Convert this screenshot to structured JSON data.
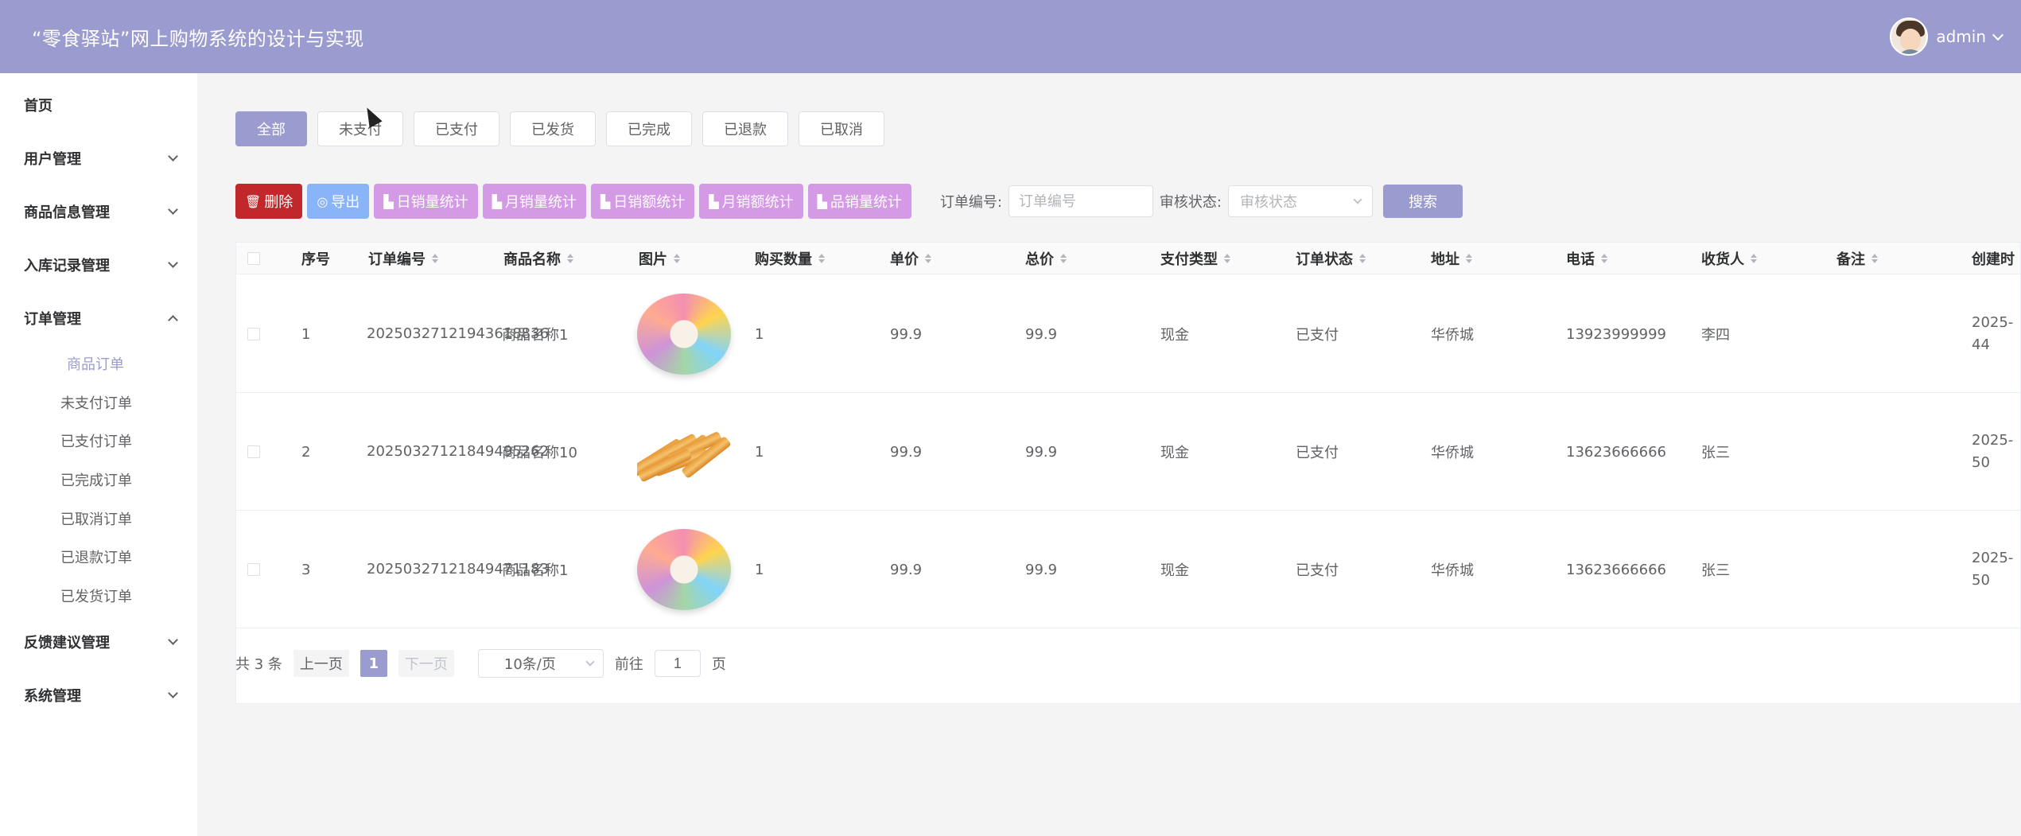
{
  "header": {
    "title": "“零食驿站”网上购物系统的设计与实现",
    "username": "admin"
  },
  "sidebar": {
    "items": [
      {
        "label": "首页"
      },
      {
        "label": "用户管理"
      },
      {
        "label": "商品信息管理"
      },
      {
        "label": "入库记录管理"
      },
      {
        "label": "订单管理"
      },
      {
        "label": "反馈建议管理"
      },
      {
        "label": "系统管理"
      }
    ],
    "order_sub": [
      {
        "label": "商品订单"
      },
      {
        "label": "未支付订单"
      },
      {
        "label": "已支付订单"
      },
      {
        "label": "已完成订单"
      },
      {
        "label": "已取消订单"
      },
      {
        "label": "已退款订单"
      },
      {
        "label": "已发货订单"
      }
    ]
  },
  "tabs": [
    {
      "label": "全部"
    },
    {
      "label": "未支付"
    },
    {
      "label": "已支付"
    },
    {
      "label": "已发货"
    },
    {
      "label": "已完成"
    },
    {
      "label": "已退款"
    },
    {
      "label": "已取消"
    }
  ],
  "toolbar": {
    "delete": "删除",
    "export": "导出",
    "day_sales_qty": "日销量统计",
    "month_sales_qty": "月销量统计",
    "day_sales_amt": "日销额统计",
    "month_sales_amt": "月销额统计",
    "product_sales_qty": "品销量统计",
    "order_no_label": "订单编号:",
    "order_no_placeholder": "订单编号",
    "audit_label": "审核状态:",
    "audit_placeholder": "审核状态",
    "search": "搜索"
  },
  "table": {
    "headers": {
      "index": "序号",
      "order_no": "订单编号",
      "product_name": "商品名称",
      "image": "图片",
      "quantity": "购买数量",
      "unit_price": "单价",
      "total_price": "总价",
      "pay_type": "支付类型",
      "order_status": "订单状态",
      "address": "地址",
      "phone": "电话",
      "receiver": "收货人",
      "remark": "备注",
      "created": "创建时"
    },
    "rows": [
      {
        "index": "1",
        "order_no": "20250327121943618836",
        "product_name": "商品名称1",
        "image": "candy-image",
        "quantity": "1",
        "unit_price": "99.9",
        "total_price": "99.9",
        "pay_type": "现金",
        "order_status": "已支付",
        "address": "华侨城",
        "phone": "13923999999",
        "receiver": "李四",
        "remark": "",
        "created_line1": "2025-",
        "created_line2": "44"
      },
      {
        "index": "2",
        "order_no": "20250327121849495262",
        "product_name": "商品名称10",
        "image": "fries-image",
        "quantity": "1",
        "unit_price": "99.9",
        "total_price": "99.9",
        "pay_type": "现金",
        "order_status": "已支付",
        "address": "华侨城",
        "phone": "13623666666",
        "receiver": "张三",
        "remark": "",
        "created_line1": "2025-",
        "created_line2": "50"
      },
      {
        "index": "3",
        "order_no": "20250327121849471183",
        "product_name": "商品名称1",
        "image": "candy-image",
        "quantity": "1",
        "unit_price": "99.9",
        "total_price": "99.9",
        "pay_type": "现金",
        "order_status": "已支付",
        "address": "华侨城",
        "phone": "13623666666",
        "receiver": "张三",
        "remark": "",
        "created_line1": "2025-",
        "created_line2": "50"
      }
    ]
  },
  "pagination": {
    "total": "共 3 条",
    "prev": "上一页",
    "current": "1",
    "next": "下一页",
    "page_size": "10条/页",
    "goto_label": "前往",
    "goto_value": "1",
    "goto_suffix": "页"
  },
  "colors": {
    "primary": "#9a9bcf",
    "danger": "#c0282b",
    "export": "#8ab4f8",
    "stat": "#d59ae6"
  }
}
